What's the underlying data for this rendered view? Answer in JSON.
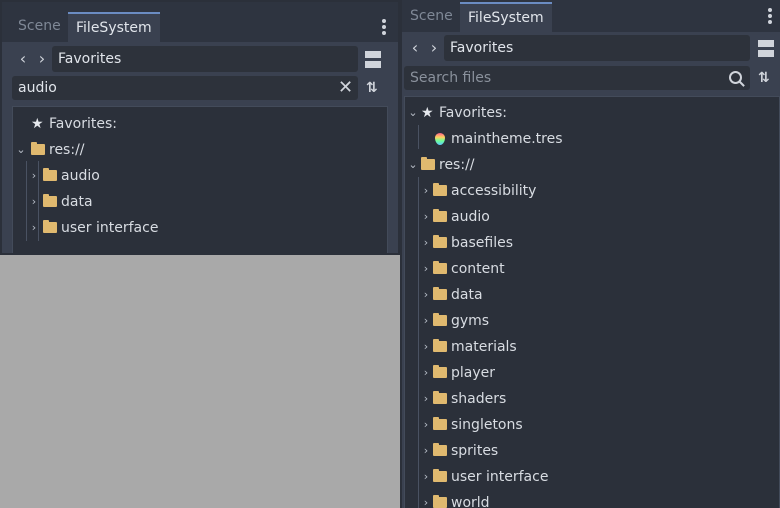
{
  "left_panel": {
    "tabs": [
      "Scene",
      "FileSystem"
    ],
    "path": "Favorites",
    "search_value": "audio",
    "tree": [
      {
        "label": "Favorites:",
        "type": "favorites"
      },
      {
        "label": "res://",
        "type": "root"
      },
      {
        "label": "audio",
        "type": "folder"
      },
      {
        "label": "data",
        "type": "folder"
      },
      {
        "label": "user interface",
        "type": "folder"
      }
    ]
  },
  "right_panel": {
    "tabs": [
      "Scene",
      "FileSystem"
    ],
    "path": "Favorites",
    "search_placeholder": "Search files",
    "tree": [
      {
        "label": "Favorites:",
        "type": "favorites"
      },
      {
        "label": "maintheme.tres",
        "type": "resource"
      },
      {
        "label": "res://",
        "type": "root"
      },
      {
        "label": "accessibility",
        "type": "folder"
      },
      {
        "label": "audio",
        "type": "folder"
      },
      {
        "label": "basefiles",
        "type": "folder"
      },
      {
        "label": "content",
        "type": "folder"
      },
      {
        "label": "data",
        "type": "folder"
      },
      {
        "label": "gyms",
        "type": "folder"
      },
      {
        "label": "materials",
        "type": "folder"
      },
      {
        "label": "player",
        "type": "folder"
      },
      {
        "label": "shaders",
        "type": "folder"
      },
      {
        "label": "singletons",
        "type": "folder"
      },
      {
        "label": "sprites",
        "type": "folder"
      },
      {
        "label": "user interface",
        "type": "folder"
      },
      {
        "label": "world",
        "type": "folder"
      }
    ]
  },
  "icons": {
    "back": "chevron-left-icon",
    "forward": "chevron-right-icon",
    "split": "split-view-icon",
    "clear": "close-icon",
    "sort": "sort-icon",
    "search": "search-icon",
    "menu": "kebab-menu-icon",
    "folder": "folder-icon",
    "star": "star-icon",
    "resource": "theme-resource-icon"
  },
  "colors": {
    "panel_bg": "#3a4150",
    "tree_bg": "#2b303a",
    "folder": "#e0b96f",
    "active_tab_accent": "#6b8cc2",
    "outside_bg": "#a9a9a9"
  }
}
